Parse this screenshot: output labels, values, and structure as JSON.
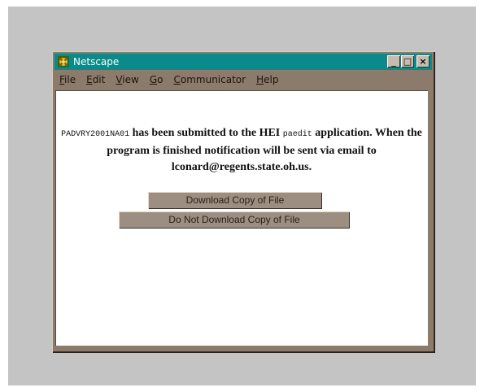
{
  "window": {
    "title": "Netscape",
    "controls": {
      "minimize": "_",
      "maximize": "□",
      "close": "×"
    }
  },
  "menu": [
    {
      "first": "F",
      "rest": "ile"
    },
    {
      "first": "E",
      "rest": "dit"
    },
    {
      "first": "V",
      "rest": "iew"
    },
    {
      "first": "G",
      "rest": "o"
    },
    {
      "first": "C",
      "rest": "ommunicator"
    },
    {
      "first": "H",
      "rest": "elp"
    }
  ],
  "message": {
    "filename": "PADVRY2001NA01",
    "part1": " has been submitted to the HEI ",
    "app_name": "paedit",
    "part2": " application. When the program is finished notification will be sent via email to lconard@regents.state.oh.us."
  },
  "buttons": {
    "download": "Download Copy of File",
    "no_download": "Do Not Download Copy of File"
  },
  "colors": {
    "titlebar": "#0a8a8a",
    "chrome": "#8c7b6b",
    "backdrop": "#c4c4c4"
  }
}
